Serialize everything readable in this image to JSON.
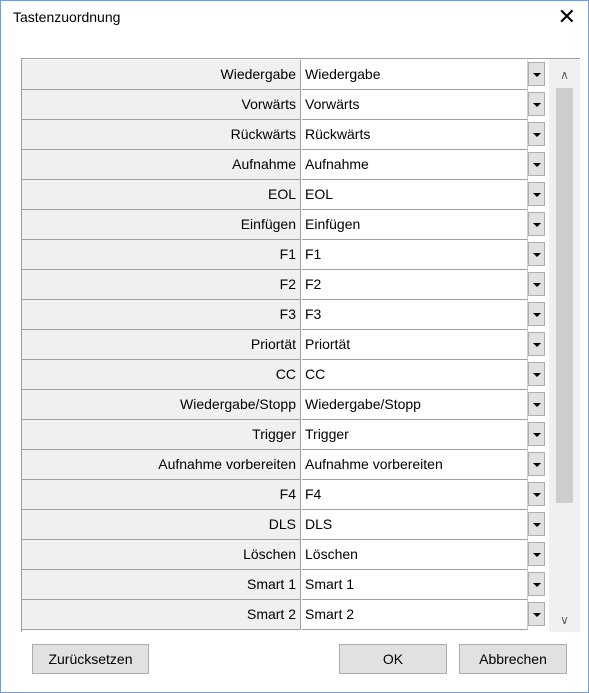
{
  "dialog": {
    "title": "Tastenzuordnung",
    "close_glyph": "✕"
  },
  "mappings": [
    {
      "label": "Wiedergabe",
      "value": "Wiedergabe"
    },
    {
      "label": "Vorwärts",
      "value": "Vorwärts"
    },
    {
      "label": "Rückwärts",
      "value": "Rückwärts"
    },
    {
      "label": "Aufnahme",
      "value": "Aufnahme"
    },
    {
      "label": "EOL",
      "value": "EOL"
    },
    {
      "label": "Einfügen",
      "value": "Einfügen"
    },
    {
      "label": "F1",
      "value": "F1"
    },
    {
      "label": "F2",
      "value": "F2"
    },
    {
      "label": "F3",
      "value": "F3"
    },
    {
      "label": "Priortät",
      "value": "Priortät"
    },
    {
      "label": "CC",
      "value": "CC"
    },
    {
      "label": "Wiedergabe/Stopp",
      "value": "Wiedergabe/Stopp"
    },
    {
      "label": "Trigger",
      "value": "Trigger"
    },
    {
      "label": "Aufnahme vorbereiten",
      "value": "Aufnahme vorbereiten"
    },
    {
      "label": "F4",
      "value": "F4"
    },
    {
      "label": "DLS",
      "value": "DLS"
    },
    {
      "label": "Löschen",
      "value": "Löschen"
    },
    {
      "label": "Smart 1",
      "value": "Smart 1"
    },
    {
      "label": "Smart 2",
      "value": "Smart 2"
    }
  ],
  "scrollbar": {
    "up_glyph": "∧",
    "down_glyph": "∨",
    "dropdown_icon": "chevron-down-icon"
  },
  "buttons": {
    "reset": "Zurücksetzen",
    "ok": "OK",
    "cancel": "Abbrechen"
  }
}
